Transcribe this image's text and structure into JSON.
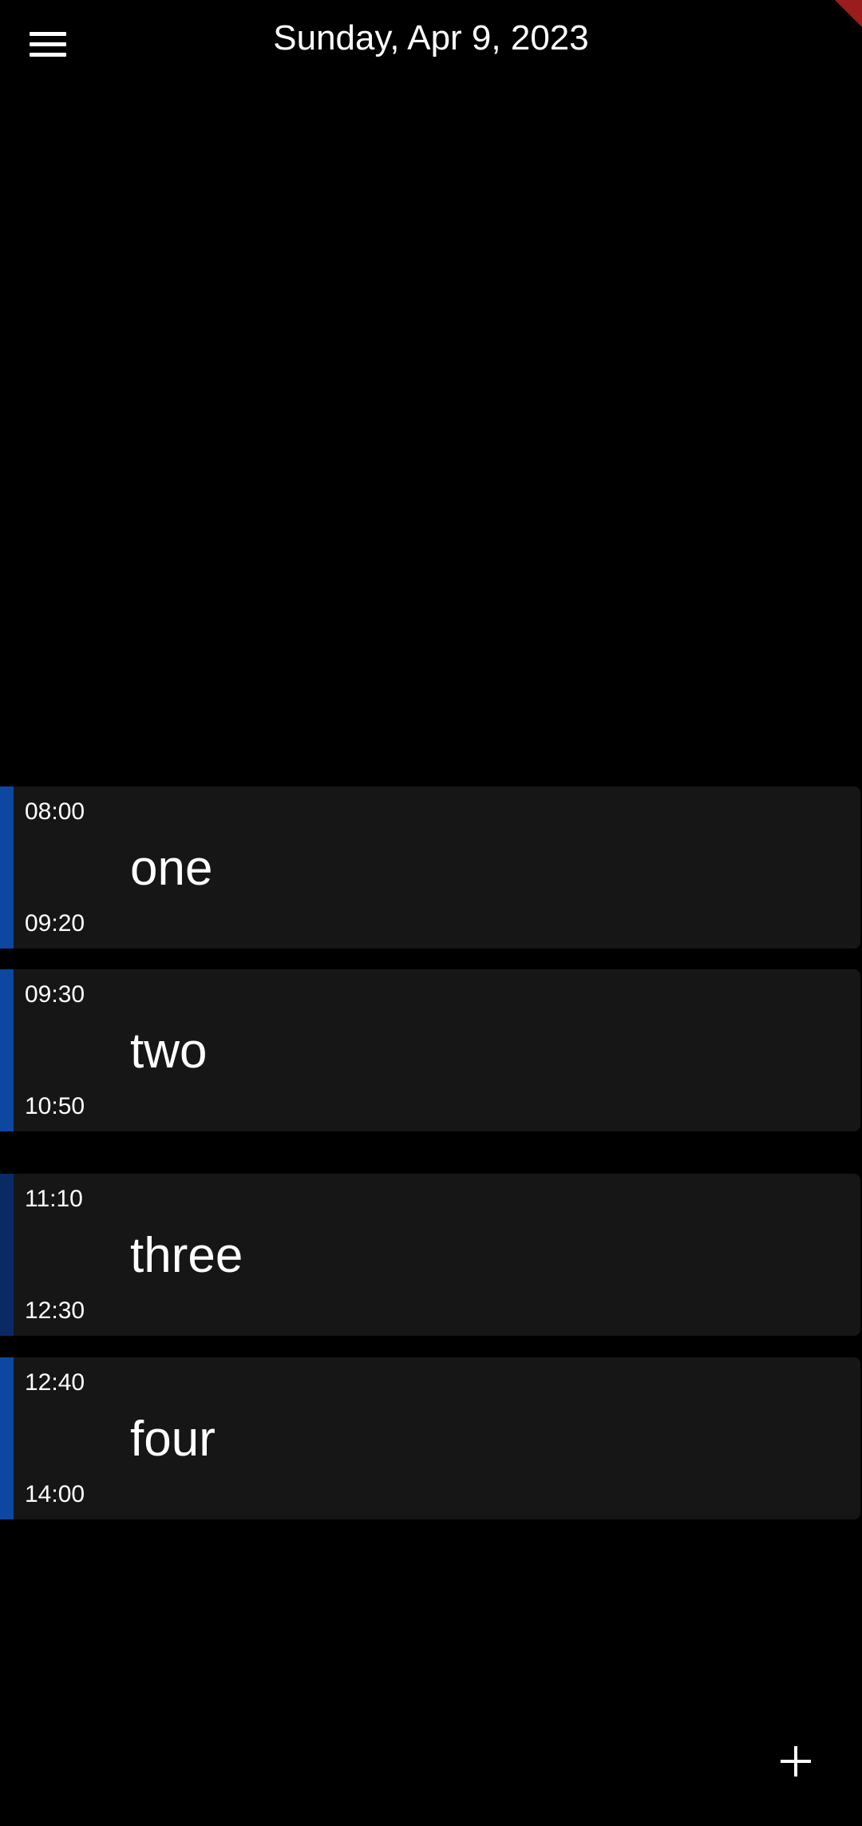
{
  "header": {
    "date": "Sunday, Apr 9, 2023",
    "menu_icon": "hamburger-menu-icon"
  },
  "events": [
    {
      "start": "08:00",
      "end": "09:20",
      "title": "one",
      "accent": "#0d47a1"
    },
    {
      "start": "09:30",
      "end": "10:50",
      "title": "two",
      "accent": "#0d47a1"
    },
    {
      "start": "11:10",
      "end": "12:30",
      "title": "three",
      "accent": "#0a2a66"
    },
    {
      "start": "12:40",
      "end": "14:00",
      "title": "four",
      "accent": "#0d47a1"
    }
  ],
  "fab": {
    "icon": "plus-icon"
  },
  "colors": {
    "background": "#000000",
    "card": "#161616",
    "text": "#ffffff",
    "debug_ribbon": "#9b1c1c"
  }
}
